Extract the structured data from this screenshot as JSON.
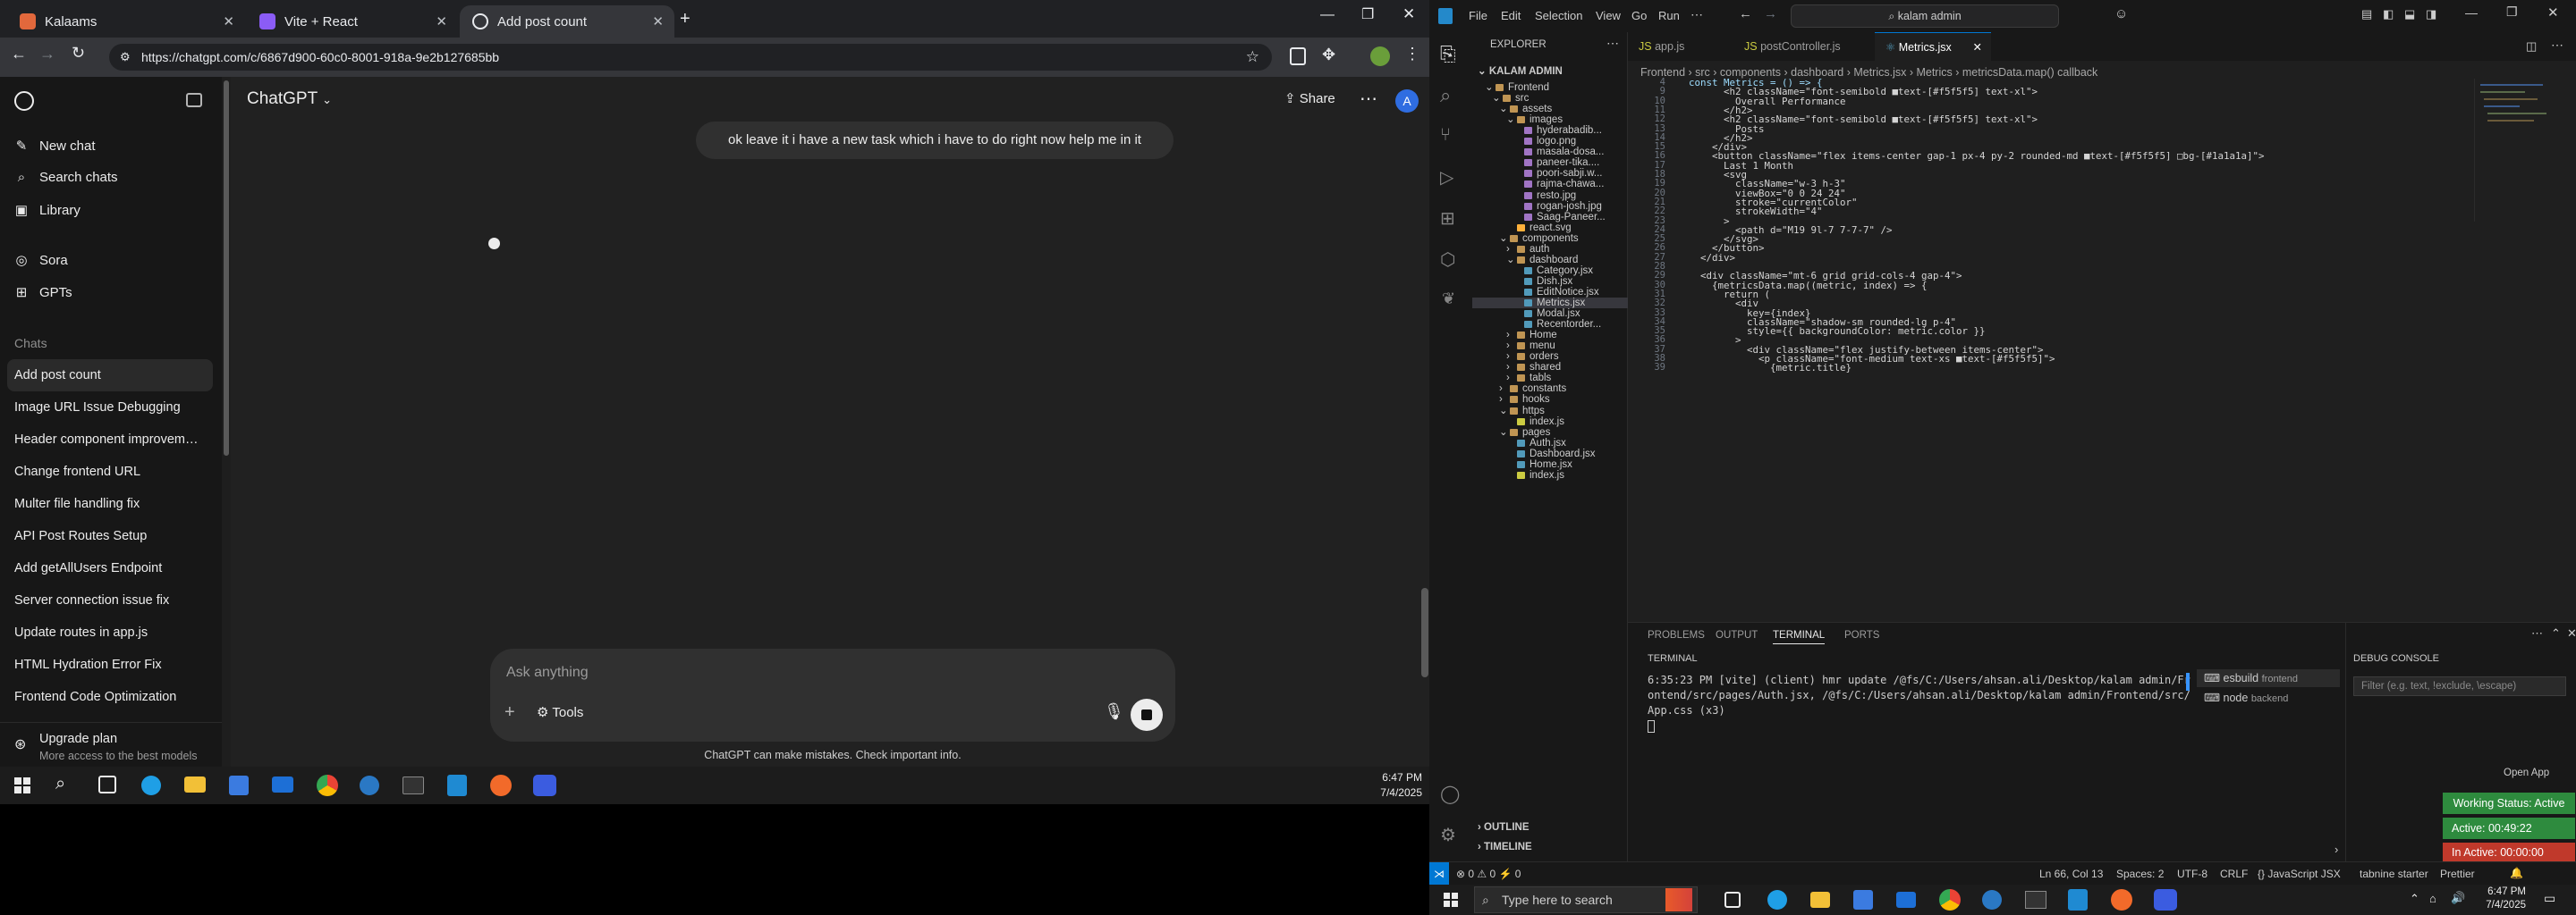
{
  "chrome": {
    "tabs": [
      {
        "title": "Kalaams",
        "icon": "kalaams-favicon-icon"
      },
      {
        "title": "Vite + React",
        "icon": "vite-favicon-icon"
      },
      {
        "title": "Add post count",
        "icon": "chatgpt-favicon-icon"
      }
    ],
    "url": "https://chatgpt.com/c/6867d900-60c0-8001-918a-9e2b127685bb"
  },
  "chatgpt": {
    "sidebar": {
      "new_chat": "New chat",
      "search_chats": "Search chats",
      "library": "Library",
      "sora": "Sora",
      "gpts": "GPTs",
      "chats_heading": "Chats",
      "chats": [
        "Add post count",
        "Image URL Issue Debugging",
        "Header component improveme...",
        "Change frontend URL",
        "Multer file handling fix",
        "API Post Routes Setup",
        "Add getAllUsers Endpoint",
        "Server connection issue fix",
        "Update routes in app.js",
        "HTML Hydration Error Fix",
        "Frontend Code Optimization"
      ],
      "upgrade_title": "Upgrade plan",
      "upgrade_sub": "More access to the best models"
    },
    "header": {
      "model": "ChatGPT",
      "share": "Share",
      "avatar": "A"
    },
    "user_message": "ok leave it i have a new task which i have to do right now help me in it",
    "composer": {
      "placeholder": "Ask anything",
      "tools": "Tools"
    },
    "disclaimer": "ChatGPT can make mistakes. Check important info."
  },
  "taskbar_left": {
    "time": "6:47 PM",
    "date": "7/4/2025"
  },
  "vscode": {
    "search": "kalam admin",
    "menu": [
      "File",
      "Edit",
      "Selection",
      "View",
      "Go",
      "Run"
    ],
    "explorer_title": "EXPLORER",
    "project": "KALAM ADMIN",
    "tree": [
      {
        "label": "Frontend",
        "depth": 1,
        "type": "folder-open"
      },
      {
        "label": "src",
        "depth": 2,
        "type": "folder-open"
      },
      {
        "label": "assets",
        "depth": 3,
        "type": "folder-open"
      },
      {
        "label": "images",
        "depth": 4,
        "type": "folder-open"
      },
      {
        "label": "hyderabadib...",
        "depth": 5,
        "type": "image"
      },
      {
        "label": "logo.png",
        "depth": 5,
        "type": "image"
      },
      {
        "label": "masala-dosa...",
        "depth": 5,
        "type": "image"
      },
      {
        "label": "paneer-tika....",
        "depth": 5,
        "type": "image"
      },
      {
        "label": "poori-sabji.w...",
        "depth": 5,
        "type": "image"
      },
      {
        "label": "rajma-chawa...",
        "depth": 5,
        "type": "image"
      },
      {
        "label": "resto.jpg",
        "depth": 5,
        "type": "image"
      },
      {
        "label": "rogan-josh.jpg",
        "depth": 5,
        "type": "image"
      },
      {
        "label": "Saag-Paneer...",
        "depth": 5,
        "type": "image"
      },
      {
        "label": "react.svg",
        "depth": 4,
        "type": "svg"
      },
      {
        "label": "components",
        "depth": 3,
        "type": "folder-open"
      },
      {
        "label": "auth",
        "depth": 4,
        "type": "folder"
      },
      {
        "label": "dashboard",
        "depth": 4,
        "type": "folder-open"
      },
      {
        "label": "Category.jsx",
        "depth": 5,
        "type": "jsx"
      },
      {
        "label": "Dish.jsx",
        "depth": 5,
        "type": "jsx"
      },
      {
        "label": "EditNotice.jsx",
        "depth": 5,
        "type": "jsx"
      },
      {
        "label": "Metrics.jsx",
        "depth": 5,
        "type": "jsx",
        "selected": true
      },
      {
        "label": "Modal.jsx",
        "depth": 5,
        "type": "jsx"
      },
      {
        "label": "Recentorder...",
        "depth": 5,
        "type": "jsx"
      },
      {
        "label": "Home",
        "depth": 4,
        "type": "folder"
      },
      {
        "label": "menu",
        "depth": 4,
        "type": "folder"
      },
      {
        "label": "orders",
        "depth": 4,
        "type": "folder"
      },
      {
        "label": "shared",
        "depth": 4,
        "type": "folder"
      },
      {
        "label": "tabls",
        "depth": 4,
        "type": "folder"
      },
      {
        "label": "constants",
        "depth": 3,
        "type": "folder"
      },
      {
        "label": "hooks",
        "depth": 3,
        "type": "folder"
      },
      {
        "label": "https",
        "depth": 3,
        "type": "folder-open"
      },
      {
        "label": "index.js",
        "depth": 4,
        "type": "js"
      },
      {
        "label": "pages",
        "depth": 3,
        "type": "folder-open"
      },
      {
        "label": "Auth.jsx",
        "depth": 4,
        "type": "jsx"
      },
      {
        "label": "Dashboard.jsx",
        "depth": 4,
        "type": "jsx"
      },
      {
        "label": "Home.jsx",
        "depth": 4,
        "type": "jsx"
      },
      {
        "label": "index.js",
        "depth": 4,
        "type": "js"
      }
    ],
    "outline": "OUTLINE",
    "timeline": "TIMELINE",
    "tabs": [
      {
        "title": "app.js",
        "icon": "js"
      },
      {
        "title": "postController.js",
        "icon": "js"
      },
      {
        "title": "Metrics.jsx",
        "icon": "jsx",
        "active": true
      }
    ],
    "breadcrumb": [
      "Frontend",
      "src",
      "components",
      "dashboard",
      "Metrics.jsx",
      "Metrics",
      "metricsData.map() callback"
    ],
    "code_lines": [
      {
        "n": "4",
        "t": "const Metrics = () => {"
      },
      {
        "n": "9",
        "t": "      <h2 className=\"font-semibold ■text-[#f5f5f5] text-xl\">"
      },
      {
        "n": "10",
        "t": "        Overall Performance"
      },
      {
        "n": "11",
        "t": "      </h2>"
      },
      {
        "n": "12",
        "t": "      <h2 className=\"font-semibold ■text-[#f5f5f5] text-xl\">"
      },
      {
        "n": "13",
        "t": "        Posts"
      },
      {
        "n": "14",
        "t": "      </h2>"
      },
      {
        "n": "15",
        "t": "    </div>"
      },
      {
        "n": "16",
        "t": "    <button className=\"flex items-center gap-1 px-4 py-2 rounded-md ■text-[#f5f5f5] □bg-[#1a1a1a]\">"
      },
      {
        "n": "17",
        "t": "      Last 1 Month"
      },
      {
        "n": "18",
        "t": "      <svg"
      },
      {
        "n": "19",
        "t": "        className=\"w-3 h-3\""
      },
      {
        "n": "20",
        "t": "        viewBox=\"0 0 24 24\""
      },
      {
        "n": "21",
        "t": "        stroke=\"currentColor\""
      },
      {
        "n": "22",
        "t": "        strokeWidth=\"4\""
      },
      {
        "n": "23",
        "t": "      >"
      },
      {
        "n": "24",
        "t": "        <path d=\"M19 9l-7 7-7-7\" />"
      },
      {
        "n": "25",
        "t": "      </svg>"
      },
      {
        "n": "26",
        "t": "    </button>"
      },
      {
        "n": "27",
        "t": "  </div>"
      },
      {
        "n": "28",
        "t": ""
      },
      {
        "n": "29",
        "t": "  <div className=\"mt-6 grid grid-cols-4 gap-4\">"
      },
      {
        "n": "30",
        "t": "    {metricsData.map((metric, index) => {"
      },
      {
        "n": "31",
        "t": "      return ("
      },
      {
        "n": "32",
        "t": "        <div"
      },
      {
        "n": "33",
        "t": "          key={index}"
      },
      {
        "n": "34",
        "t": "          className=\"shadow-sm rounded-lg p-4\""
      },
      {
        "n": "35",
        "t": "          style={{ backgroundColor: metric.color }}"
      },
      {
        "n": "36",
        "t": "        >"
      },
      {
        "n": "37",
        "t": "          <div className=\"flex justify-between items-center\">"
      },
      {
        "n": "38",
        "t": "            <p className=\"font-medium text-xs ■text-[#f5f5f5]\">"
      },
      {
        "n": "39",
        "t": "              {metric.title}"
      }
    ],
    "panel_tabs": [
      "PROBLEMS",
      "OUTPUT",
      "TERMINAL",
      "PORTS"
    ],
    "terminal_title": "TERMINAL",
    "terminal_lines": [
      "6:35:23 PM [vite] (client) hmr update /@fs/C:/Users/ahsan.ali/Desktop/kalam admin/Fr",
      "ontend/src/pages/Auth.jsx, /@fs/C:/Users/ahsan.ali/Desktop/kalam admin/Frontend/src/",
      "App.css (x3)"
    ],
    "terminals": [
      {
        "name": "esbuild",
        "tag": "frontend"
      },
      {
        "name": "node",
        "tag": "backend"
      }
    ],
    "debug_title": "DEBUG CONSOLE",
    "debug_filter": "Filter (e.g. text, !exclude, \\escape)",
    "open_app": "Open App",
    "working_status": "Working Status: Active",
    "active_time": "Active: 00:49:22",
    "inactive_time": "In Active: 00:00:00",
    "status_left": "⊗ 0  ⚠ 0   ⚡ 0",
    "status_right": [
      "Ln 66, Col 13",
      "Spaces: 2",
      "UTF-8",
      "CRLF",
      "{} JavaScript JSX",
      "tabnine starter",
      "Prettier"
    ]
  },
  "taskbar_right": {
    "search_placeholder": "Type here to search",
    "time": "6:47 PM",
    "date": "7/4/2025"
  }
}
